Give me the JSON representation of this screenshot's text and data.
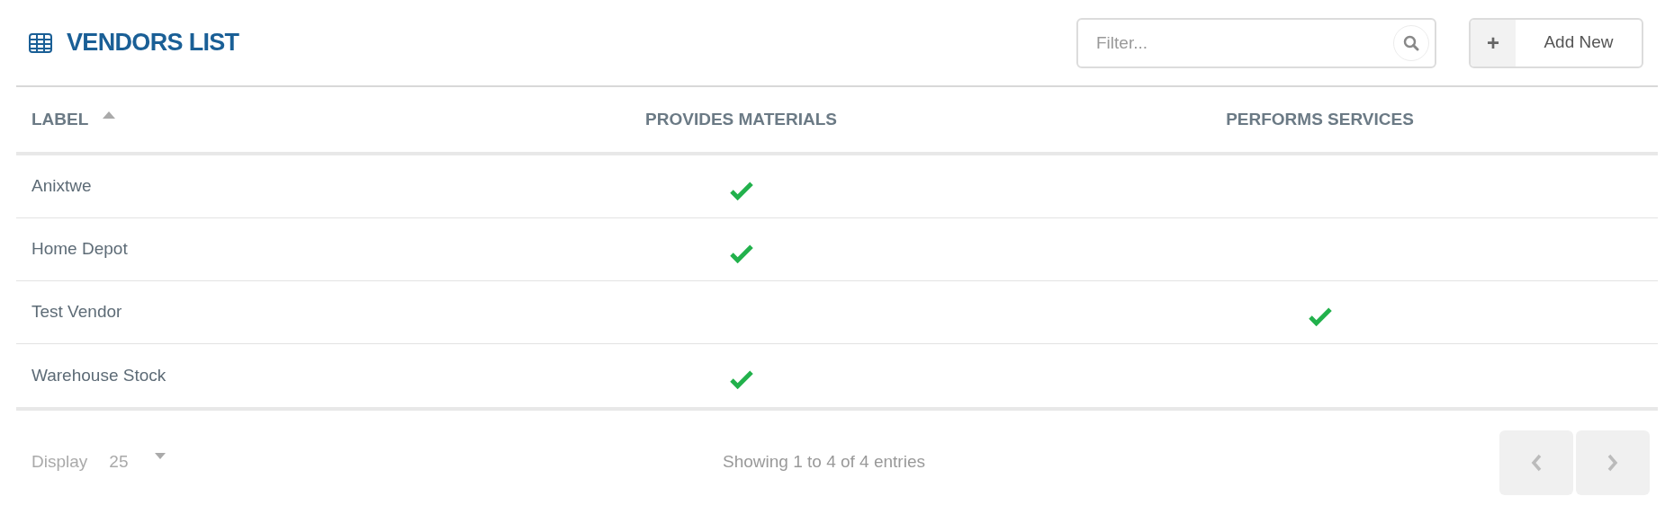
{
  "title": "VENDORS LIST",
  "filter": {
    "placeholder": "Filter..."
  },
  "add_button": {
    "icon": "+",
    "label": "Add New"
  },
  "table": {
    "columns": [
      {
        "label": "LABEL",
        "sorted": true
      },
      {
        "label": "PROVIDES MATERIALS",
        "sorted": false
      },
      {
        "label": "PERFORMS SERVICES",
        "sorted": false
      }
    ],
    "rows": [
      {
        "label": "Anixtwe",
        "provides_materials": true,
        "performs_services": false
      },
      {
        "label": "Home Depot",
        "provides_materials": true,
        "performs_services": false
      },
      {
        "label": "Test Vendor",
        "provides_materials": false,
        "performs_services": true
      },
      {
        "label": "Warehouse Stock",
        "provides_materials": true,
        "performs_services": false
      }
    ]
  },
  "footer": {
    "display_label": "Display",
    "page_size": "25",
    "summary": "Showing 1 to 4 of 4 entries",
    "prev_disabled": true,
    "next_disabled": true
  }
}
